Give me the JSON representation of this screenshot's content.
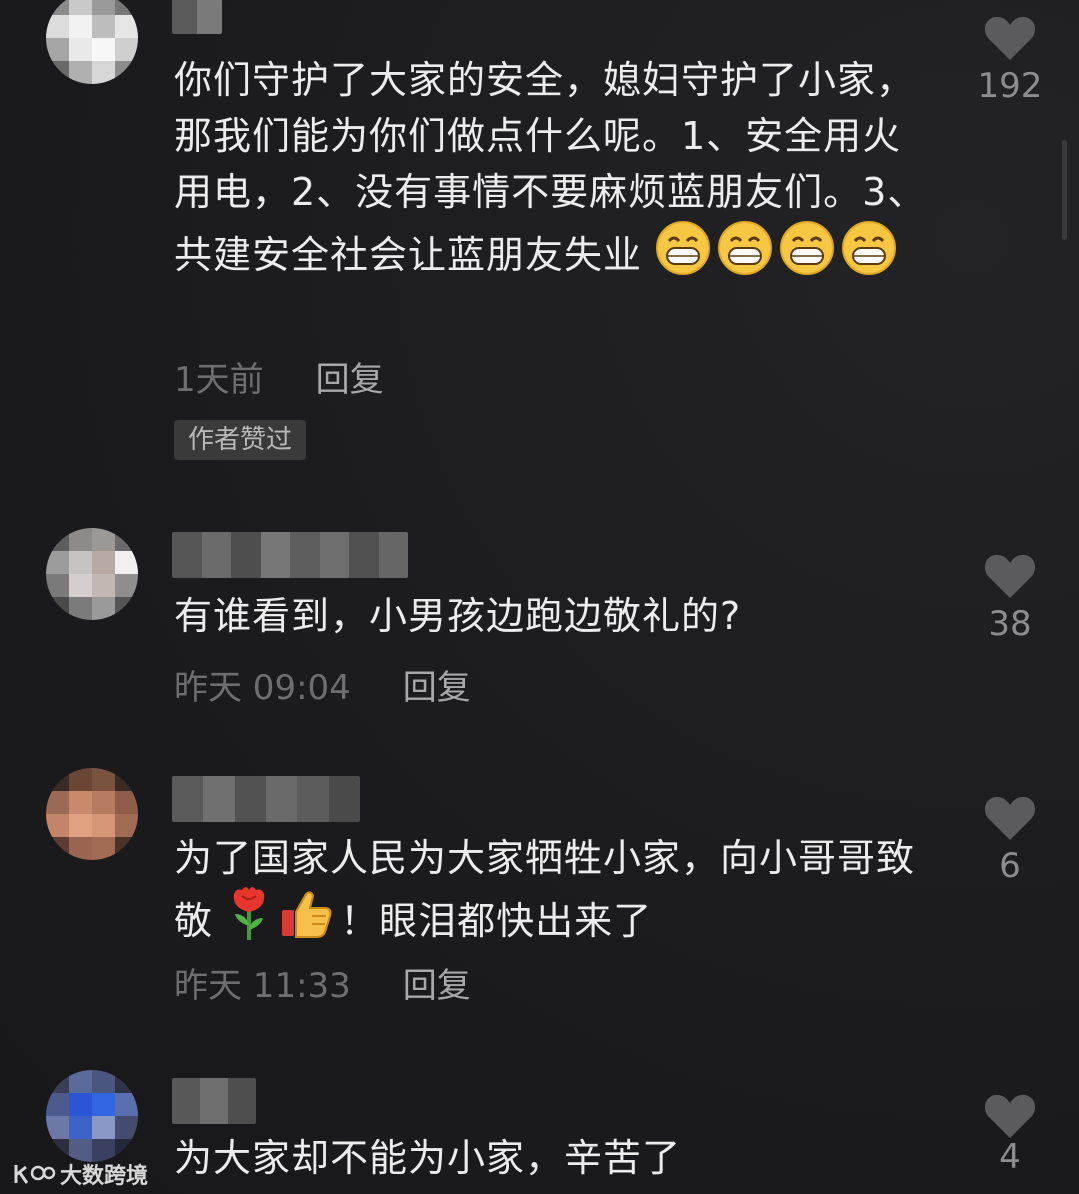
{
  "comments": [
    {
      "text": "你们守护了大家的安全，媳妇守护了小家，那我们能为你们做点什么呢。1、安全用火用电，2、没有事情不要麻烦蓝朋友们。3、共建安全社会让蓝朋友失业",
      "time": "1天前",
      "reply": "回复",
      "badge": "作者赞过",
      "likes": "192"
    },
    {
      "text": "有谁看到，小男孩边跑边敬礼的?",
      "time": "昨天 09:04",
      "reply": "回复",
      "likes": "38"
    },
    {
      "text": "为了国家人民为大家牺牲小家，向小哥哥致敬",
      "text_tail": "！眼泪都快出来了",
      "time": "昨天 11:33",
      "reply": "回复",
      "likes": "6"
    },
    {
      "text": "为大家却不能为小家，辛苦了",
      "likes": "4"
    }
  ],
  "icons": {
    "like": "heart-icon",
    "grin": "grinning-face-emoji",
    "rose": "rose-emoji",
    "thumbs": "thumbs-up-emoji"
  },
  "watermark": {
    "text": "大数跨境"
  },
  "colors": {
    "background": "#1d1d1f",
    "text": "#ececec",
    "meta": "#6e6e70",
    "heart": "#5b5b5d"
  }
}
